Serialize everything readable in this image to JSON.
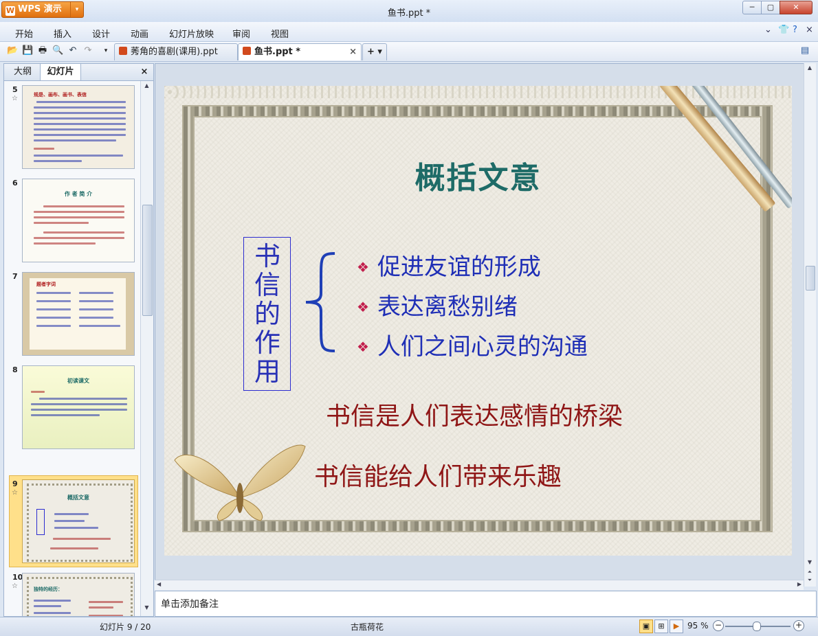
{
  "app": {
    "logo_label": "WPS 演示",
    "doc_title": "鱼书.ppt *"
  },
  "menu": [
    "开始",
    "插入",
    "设计",
    "动画",
    "幻灯片放映",
    "审阅",
    "视图"
  ],
  "tabs": [
    {
      "label": "莠角的喜剧(课用).ppt",
      "active": false
    },
    {
      "label": "鱼书.ppt *",
      "active": true
    }
  ],
  "left_panel": {
    "tab_outline": "大纲",
    "tab_slides": "幻灯片",
    "close": "×"
  },
  "thumbnails": [
    {
      "num": "5",
      "title": "规是、画布、画书、表信"
    },
    {
      "num": "6",
      "title": "作 者 简 介"
    },
    {
      "num": "7",
      "title": "题者字词"
    },
    {
      "num": "8",
      "title": "初读课文"
    },
    {
      "num": "9",
      "title": "概括文意"
    },
    {
      "num": "10",
      "title": "独特的经历："
    }
  ],
  "slide": {
    "title": "概括文意",
    "vertical_label": [
      "书",
      "信",
      "的",
      "作",
      "用"
    ],
    "bullets": [
      "促进友谊的形成",
      "表达离愁别绪",
      "人们之间心灵的沟通"
    ],
    "line1": "书信是人们表达感情的桥梁",
    "line2": "书信能给人们带来乐趣"
  },
  "notes_placeholder": "单击添加备注",
  "status": {
    "slide_count": "幻灯片 9 / 20",
    "theme": "古瓶荷花",
    "zoom": "95 %"
  },
  "icons": {
    "bullet": "❖"
  },
  "colors": {
    "title": "#1e6b67",
    "bullet_text": "#1f2fb6",
    "red_text": "#8f1616",
    "accent_orange": "#e0700f"
  }
}
